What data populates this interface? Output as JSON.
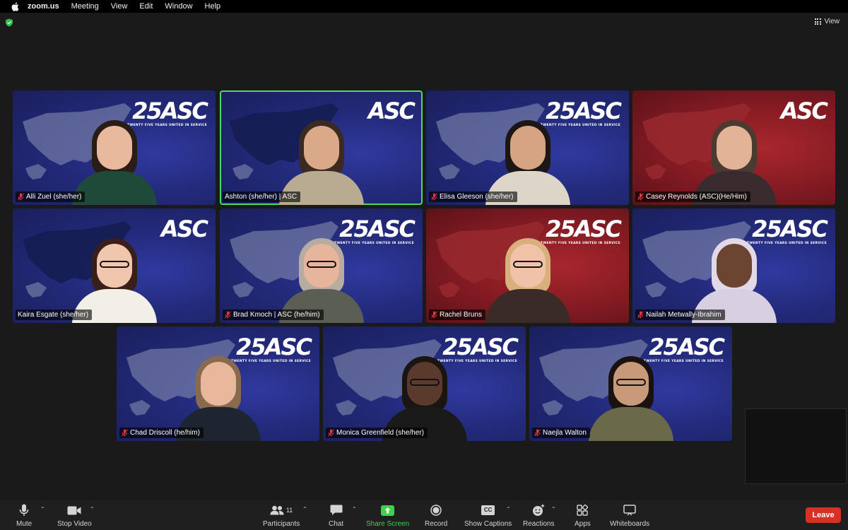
{
  "menubar": {
    "items": [
      "zoom.us",
      "Meeting",
      "View",
      "Edit",
      "Window",
      "Help"
    ]
  },
  "topbar": {
    "view_label": "View"
  },
  "participants": [
    {
      "name": "Alli Zuel (she/her)",
      "bg": "blue",
      "logo": "25ASC",
      "muted": true,
      "skin": "#e8b99c",
      "hair": "#2a1c17",
      "shirt": "#1f4a3a"
    },
    {
      "name": "Ashton (she/her)  | ASC",
      "bg": "blue",
      "logo": "ASC",
      "muted": false,
      "active": true,
      "skin": "#d9a98a",
      "hair": "#3b2a22",
      "shirt": "#b8ab92"
    },
    {
      "name": "Elisa Gleeson (she/her)",
      "bg": "blue",
      "logo": "25ASC",
      "muted": true,
      "skin": "#d6a483",
      "hair": "#1c1714",
      "shirt": "#ddd5c8"
    },
    {
      "name": "Casey Reynolds (ASC)(He/Him)",
      "bg": "red",
      "logo": "ASC",
      "muted": true,
      "skin": "#e3b397",
      "hair": "#4a3a30",
      "shirt": "#3a2b2f"
    },
    {
      "name": "Kaira Esgate (she/her)",
      "bg": "blue",
      "logo": "ASC",
      "muted": false,
      "skin": "#f0c7ad",
      "hair": "#3a1e1c",
      "shirt": "#f2efe6",
      "glasses": true
    },
    {
      "name": "Brad Kmoch | ASC (he/him)",
      "bg": "blue",
      "logo": "25ASC",
      "muted": true,
      "skin": "#e6b59b",
      "hair": "#b8aca0",
      "shirt": "#5a5e54",
      "glasses": true
    },
    {
      "name": "Rachel Bruns",
      "bg": "red",
      "logo": "25ASC",
      "muted": true,
      "skin": "#f0c2a8",
      "hair": "#d8b07c",
      "shirt": "#3a2b26",
      "glasses": true
    },
    {
      "name": "Nailah Metwally-Ibrahim",
      "bg": "blue",
      "logo": "25ASC",
      "muted": true,
      "skin": "#6b4432",
      "hair": "#e3d8e8",
      "shirt": "#d9cfe2"
    },
    {
      "name": "Chad Driscoll (he/him)",
      "bg": "blue",
      "logo": "25ASC",
      "muted": true,
      "skin": "#e9b79c",
      "hair": "#8a6a4e",
      "shirt": "#1c2530"
    },
    {
      "name": "Monica Greenfield (she/her)",
      "bg": "blue",
      "logo": "25ASC",
      "muted": true,
      "skin": "#5a3a2c",
      "hair": "#1a1412",
      "shirt": "#1a1a1a",
      "glasses": true
    },
    {
      "name": "Naejla Walton",
      "bg": "blue",
      "logo": "25ASC",
      "muted": true,
      "skin": "#c99a7a",
      "hair": "#1a1210",
      "shirt": "#6a6a4a",
      "glasses": true
    }
  ],
  "logo_tagline": "TWENTY FIVE YEARS UNITED IN SERVICE",
  "toolbar": {
    "mute": "Mute",
    "stop_video": "Stop Video",
    "participants": "Participants",
    "participant_count": "11",
    "chat": "Chat",
    "share_screen": "Share Screen",
    "record": "Record",
    "show_captions": "Show Captions",
    "captions_icon": "CC",
    "reactions": "Reactions",
    "apps": "Apps",
    "whiteboards": "Whiteboards",
    "leave": "Leave"
  },
  "colors": {
    "active_speaker": "#4cd964",
    "share_green": "#3fd14f",
    "leave_red": "#d93025"
  }
}
